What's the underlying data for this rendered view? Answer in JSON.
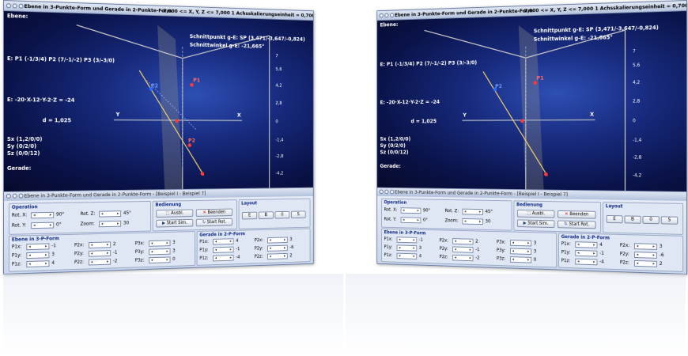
{
  "window": {
    "title": "Ebene in 3-Punkte-Form und Gerade in 2-Punkte-Form",
    "info": "-7,000 <= X, Y, Z <= 7,000    1 Achsskalierungseinheit = 0,700 LE"
  },
  "plot": {
    "ebene_heading": "Ebene:",
    "ebene_param_text": "E: P1 (-1/3/4)   P2 (7/-1/-2)   P3 (3/-3/0)",
    "normal_eq": "E: -20·X-12·Y-2·Z = -24",
    "d_value": "d = 1,025",
    "sx": "Sx (1,2/0/0)",
    "sy": "Sy (0/2/0)",
    "sz": "Sz (0/0/12)",
    "gerade_heading": "Gerade:",
    "schnittpunkt": "Schnittpunkt g-E: SP (3,471/-3,647/-0,824)",
    "schnittwinkel": "Schnittwinkel g-E: -21,665°",
    "axis_x": "X",
    "axis_y": "Y",
    "axis_z": "Z",
    "ticks_right": [
      "7",
      "5,6",
      "4,2",
      "2,8",
      "1,4",
      "0",
      "-1,4",
      "-2,8",
      "-4,2"
    ],
    "point_p1": "P1",
    "point_p2": "P2",
    "point_p3": "P3"
  },
  "panel": {
    "title": "Ebene in 3-Punkte-Form und Gerade in 2-Punkte-Form - [Beispiel I - Beispiel 7]",
    "operation": {
      "label": "Operation",
      "rotx_label": "Rot. X:",
      "rotx_value": "90°",
      "roty_label": "Rot. Y:",
      "roty_value": "0°",
      "rotz_label": "Rot. Z:",
      "rotz_value": "45°",
      "zoom_label": "Zoom:",
      "zoom_value": "30"
    },
    "bedienung": {
      "label": "Bedienung",
      "ausbl": "Ausbl.",
      "beenden": "Beenden",
      "start_sim": "Start Sim.",
      "start_rot": "Start Rot."
    },
    "layout": {
      "label": "Layout",
      "b1": "E",
      "b2": "B",
      "b3": "0",
      "b4": "S"
    },
    "ebene3p": {
      "label": "Ebene in 3-P-Form",
      "rows": [
        {
          "a": "P1x:",
          "av": "-1",
          "b": "P2x:",
          "bv": "2",
          "c": "P3x:",
          "cv": "3"
        },
        {
          "a": "P1y:",
          "av": "3",
          "b": "P2y:",
          "bv": "-1",
          "c": "P3y:",
          "cv": "3"
        },
        {
          "a": "P1z:",
          "av": "4",
          "b": "P2z:",
          "bv": "-2",
          "c": "P3z:",
          "cv": "0"
        }
      ]
    },
    "gerade2p": {
      "label": "Gerade in 2-P-Form",
      "rows": [
        {
          "a": "P1x:",
          "av": "4",
          "b": "P2x:",
          "bv": "3"
        },
        {
          "a": "P1y:",
          "av": "-1",
          "b": "P2y:",
          "bv": "-6"
        },
        {
          "a": "P1z:",
          "av": "-4",
          "b": "P2z:",
          "bv": "2"
        }
      ]
    }
  },
  "colors": {
    "plot_bg": "#0a134a",
    "panel_bg": "#dfe7f4",
    "plane_line": "#c8c8c8",
    "axis": "#9aa3b8",
    "line_g": "#ffd966",
    "point_red": "#ff3a3a",
    "point_blue": "#2b6bff"
  },
  "icons": [
    "window-dot-icon",
    "ausbl-icon",
    "beenden-icon",
    "start-sim-icon",
    "start-rot-icon"
  ]
}
